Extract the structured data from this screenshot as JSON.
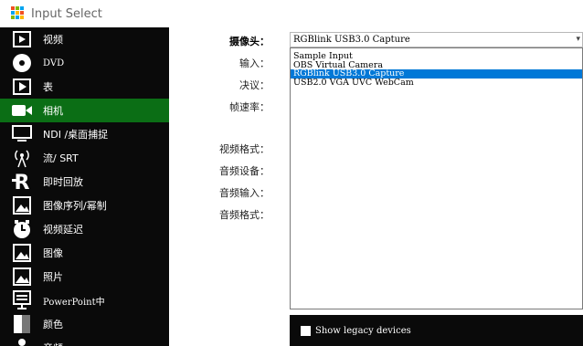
{
  "window": {
    "title": "Input Select",
    "icon": "grid-app-icon"
  },
  "sidebar": {
    "items": [
      {
        "label": "视频",
        "icon": "video-file-icon",
        "mono": false
      },
      {
        "label": "DVD",
        "icon": "dvd-disc-icon",
        "mono": true
      },
      {
        "label": "表",
        "icon": "play-table-icon",
        "mono": false
      },
      {
        "label": "相机",
        "icon": "camera-icon",
        "mono": false,
        "active": true
      },
      {
        "label": "NDI /桌面捕捉",
        "icon": "monitor-icon",
        "mono": false
      },
      {
        "label": "流/ SRT",
        "icon": "stream-antenna-icon",
        "mono": false
      },
      {
        "label": "即时回放",
        "icon": "replay-r-icon",
        "mono": false
      },
      {
        "label": "图像序列/幂制",
        "icon": "image-sequence-icon",
        "mono": false
      },
      {
        "label": "视频延迟",
        "icon": "clock-delay-icon",
        "mono": false
      },
      {
        "label": "图像",
        "icon": "image-icon",
        "mono": false
      },
      {
        "label": "照片",
        "icon": "photos-icon",
        "mono": false
      },
      {
        "label": "PowerPoint中",
        "icon": "presentation-icon",
        "mono": true
      },
      {
        "label": "颜色",
        "icon": "color-icon",
        "mono": false
      },
      {
        "label": "音频",
        "icon": "audio-icon",
        "mono": false
      }
    ]
  },
  "form": {
    "camera_label": "摄像头：",
    "input_label": "输入：",
    "resolution_label": "决议：",
    "framerate_label": "帧速率：",
    "video_format_label": "视频格式：",
    "audio_device_label": "音频设备：",
    "audio_input_label": "音频输入：",
    "audio_format_label": "音频格式："
  },
  "camera_select": {
    "value": "RGBlink USB3.0 Capture",
    "options": [
      {
        "label": "Sample Input",
        "selected": false
      },
      {
        "label": "OBS Virtual Camera",
        "selected": false
      },
      {
        "label": "RGBlink USB3.0 Capture",
        "selected": true
      },
      {
        "label": "USB2.0 VGA UVC WebCam",
        "selected": false
      }
    ]
  },
  "legacy": {
    "label": "Show legacy devices",
    "checked": false
  },
  "colors": {
    "sidebar_bg": "#0a0a0a",
    "active_bg": "#0b6e15",
    "selection": "#0078d7"
  }
}
